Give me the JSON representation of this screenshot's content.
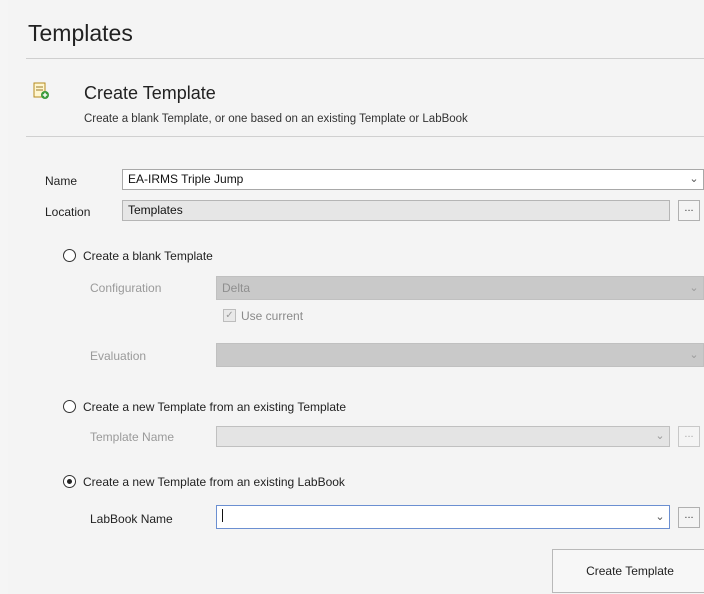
{
  "page": {
    "title": "Templates"
  },
  "section": {
    "title": "Create Template",
    "subtitle": "Create a blank Template, or one based on an existing Template or LabBook",
    "icon": "template-add-icon"
  },
  "form": {
    "name_label": "Name",
    "name_value": "EA-IRMS Triple Jump",
    "location_label": "Location",
    "location_value": "Templates",
    "browse_label": "..."
  },
  "options": {
    "blank": {
      "label": "Create a blank Template",
      "selected": false,
      "configuration_label": "Configuration",
      "configuration_value": "Delta",
      "use_current_label": "Use current",
      "evaluation_label": "Evaluation",
      "evaluation_value": ""
    },
    "from_template": {
      "label": "Create a new Template from an existing Template",
      "selected": false,
      "template_name_label": "Template Name",
      "template_name_value": ""
    },
    "from_labbook": {
      "label": "Create a new Template from an existing LabBook",
      "selected": true,
      "labbook_name_label": "LabBook Name",
      "labbook_name_value": ""
    }
  },
  "actions": {
    "create_label": "Create Template"
  },
  "colors": {
    "background": "#f4f4f4",
    "disabled_field": "#c9c9c9",
    "focus_border": "#6b8fd1"
  }
}
